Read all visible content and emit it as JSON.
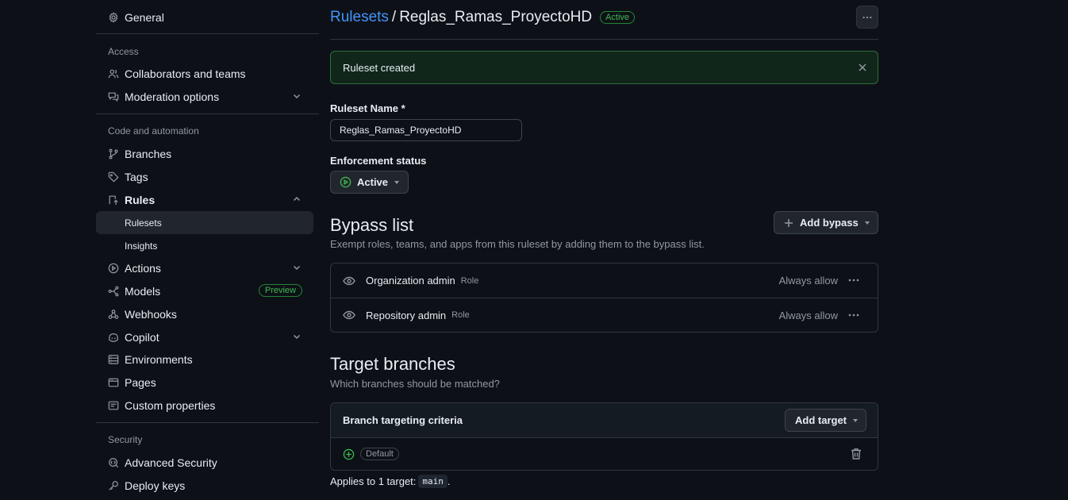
{
  "sidebar": {
    "general": "General",
    "access_label": "Access",
    "collaborators": "Collaborators and teams",
    "moderation": "Moderation options",
    "code_label": "Code and automation",
    "branches": "Branches",
    "tags": "Tags",
    "rules": "Rules",
    "rulesets": "Rulesets",
    "insights": "Insights",
    "actions": "Actions",
    "models": "Models",
    "models_badge": "Preview",
    "webhooks": "Webhooks",
    "copilot": "Copilot",
    "environments": "Environments",
    "pages": "Pages",
    "custom_properties": "Custom properties",
    "security_label": "Security",
    "advanced_security": "Advanced Security",
    "deploy_keys": "Deploy keys"
  },
  "header": {
    "crumb_link": "Rulesets",
    "separator": "/",
    "title": "Reglas_Ramas_ProyectoHD",
    "status": "Active"
  },
  "flash": {
    "message": "Ruleset created"
  },
  "form": {
    "name_label": "Ruleset Name *",
    "name_value": "Reglas_Ramas_ProyectoHD",
    "enforcement_label": "Enforcement status",
    "enforcement_value": "Active"
  },
  "bypass": {
    "title": "Bypass list",
    "description": "Exempt roles, teams, and apps from this ruleset by adding them to the bypass list.",
    "add_button": "Add bypass",
    "items": [
      {
        "name": "Organization admin",
        "type": "Role",
        "mode": "Always allow"
      },
      {
        "name": "Repository admin",
        "type": "Role",
        "mode": "Always allow"
      }
    ]
  },
  "targets": {
    "title": "Target branches",
    "description": "Which branches should be matched?",
    "criteria_label": "Branch targeting criteria",
    "add_button": "Add target",
    "default_label": "Default",
    "applies_text": "Applies to 1 target:",
    "target_code": "main",
    "period": "."
  },
  "colors": {
    "accent": "#4493f8",
    "success": "#3fb950",
    "background": "#0d1117"
  }
}
